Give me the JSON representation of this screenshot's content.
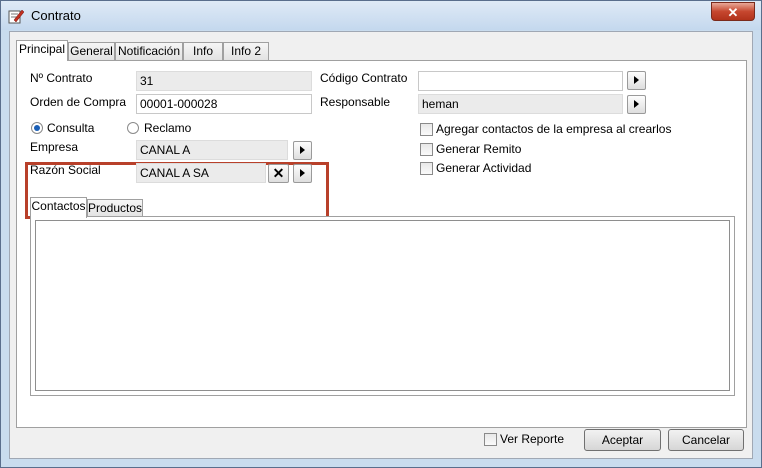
{
  "window": {
    "title": "Contrato",
    "close_glyph": "✕",
    "icon": "contract-edit-icon"
  },
  "tabs": [
    "Principal",
    "General",
    "Notificación",
    "Info",
    "Info 2"
  ],
  "form": {
    "contrato_label": "Nº Contrato",
    "contrato_value": "31",
    "orden_label": "Orden de Compra",
    "orden_value": "00001-000028",
    "codigo_label": "Código Contrato",
    "codigo_value": "",
    "responsable_label": "Responsable",
    "responsable_value": "heman",
    "radio_consulta": "Consulta",
    "radio_reclamo": "Reclamo",
    "selected_radio": "Consulta",
    "empresa_label": "Empresa",
    "empresa_value": "CANAL A",
    "razon_label": "Razón Social",
    "razon_value": "CANAL A SA",
    "chk_agregar": "Agregar contactos de la empresa al crearlos",
    "chk_remito": "Generar Remito",
    "chk_actividad": "Generar Actividad"
  },
  "inner_tabs": [
    "Contactos",
    "Productos"
  ],
  "footer": {
    "ver_reporte": "Ver Reporte",
    "aceptar": "Aceptar",
    "cancelar": "Cancelar"
  },
  "colors": {
    "highlight": "#b8402a",
    "accent": "#1b5fb6"
  }
}
